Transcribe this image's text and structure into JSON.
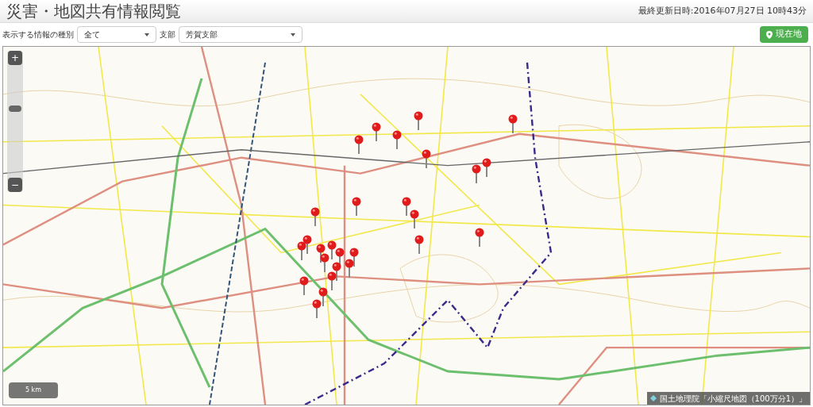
{
  "header": {
    "title": "災害・地図共有情報閲覧",
    "last_updated": "最終更新日時:2016年07月27日 10時43分"
  },
  "filters": [
    {
      "label": "表示する情報の種別",
      "value": "全て"
    },
    {
      "label": "支部",
      "value": "芳賀支部"
    }
  ],
  "location_button": {
    "label": "現在地"
  },
  "map": {
    "zoom_in": "+",
    "zoom_out": "−",
    "zoom_slider": {
      "level": 0.62
    },
    "scale": "5 km",
    "attribution": "国土地理院「小縮尺地図（100万分1）」"
  }
}
